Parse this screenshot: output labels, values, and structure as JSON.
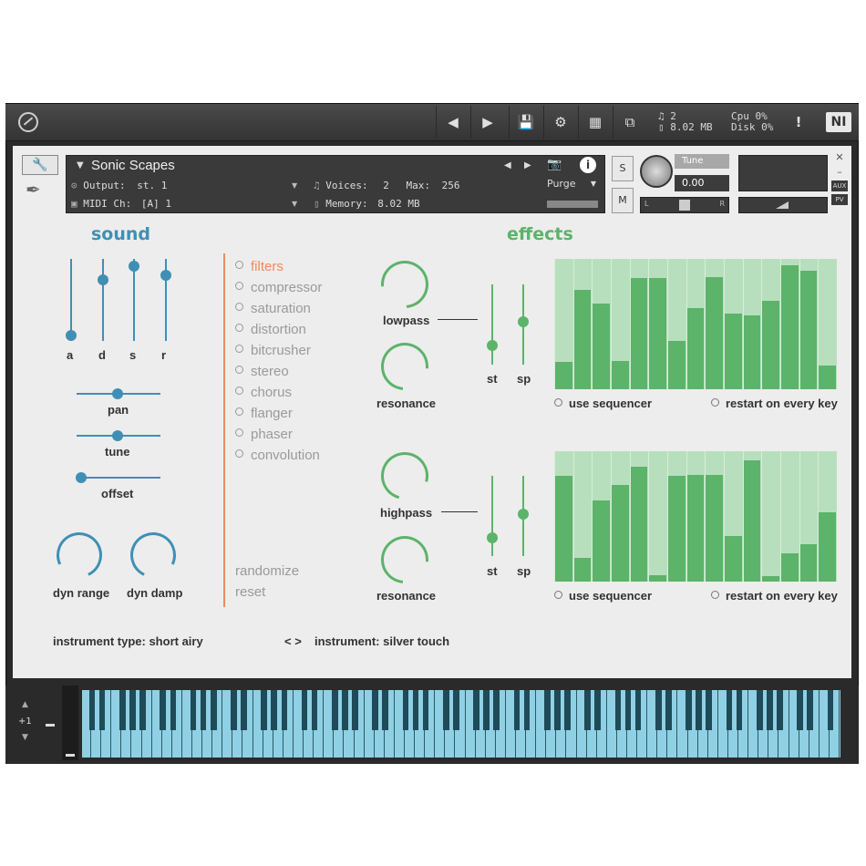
{
  "topbar": {
    "voices": "2",
    "memory": "8.02 MB",
    "cpu": "Cpu 0%",
    "disk": "Disk 0%",
    "brand": "NI"
  },
  "header": {
    "instrument_name": "Sonic Scapes",
    "output_label": "Output:",
    "output_value": "st. 1",
    "voices_label": "Voices:",
    "voices_value": "2",
    "max_label": "Max:",
    "max_value": "256",
    "midi_label": "MIDI Ch:",
    "midi_value": "[A] 1",
    "memory_label": "Memory:",
    "memory_value": "8.02 MB",
    "purge_label": "Purge",
    "solo": "S",
    "mute": "M",
    "tune_label": "Tune",
    "tune_value": "0.00",
    "pan_left": "L",
    "pan_right": "R",
    "aux": "AUX",
    "pv": "PV"
  },
  "sound": {
    "title": "sound",
    "color": "#3f8fb5",
    "adsr": [
      {
        "label": "a",
        "level": 0.0
      },
      {
        "label": "d",
        "level": 0.78
      },
      {
        "label": "s",
        "level": 0.98
      },
      {
        "label": "r",
        "level": 0.85
      }
    ],
    "pan_label": "pan",
    "tune_label": "tune",
    "offset_label": "offset",
    "dyn_range_label": "dyn range",
    "dyn_damp_label": "dyn damp"
  },
  "effects_menu": {
    "items": [
      "filters",
      "compressor",
      "saturation",
      "distortion",
      "bitcrusher",
      "stereo",
      "chorus",
      "flanger",
      "phaser",
      "convolution"
    ],
    "active": "filters",
    "active_color": "#f08a5d",
    "randomize": "randomize",
    "reset": "reset"
  },
  "effects": {
    "title": "effects",
    "color": "#5cb36a",
    "lowpass_label": "lowpass",
    "resonance_label": "resonance",
    "highpass_label": "highpass",
    "resonance2_label": "resonance",
    "st_label": "st",
    "sp_label": "sp",
    "st2_label": "st",
    "sp2_label": "sp",
    "use_sequencer": "use sequencer",
    "restart_on_every_key": "restart on every key",
    "use_sequencer2": "use sequencer",
    "restart_on_every_key2": "restart on every key",
    "seq1_values": [
      0.21,
      0.76,
      0.66,
      0.22,
      0.85,
      0.85,
      0.37,
      0.62,
      0.86,
      0.58,
      0.57,
      0.68,
      0.95,
      0.91,
      0.18
    ],
    "seq2_values": [
      0.81,
      0.18,
      0.62,
      0.74,
      0.88,
      0.05,
      0.81,
      0.82,
      0.82,
      0.35,
      0.93,
      0.04,
      0.22,
      0.29,
      0.53
    ]
  },
  "footer": {
    "instrument_type": "instrument type: short airy",
    "nav": "< >",
    "instrument": "instrument: silver touch"
  },
  "keyboard": {
    "octave": "+1"
  }
}
